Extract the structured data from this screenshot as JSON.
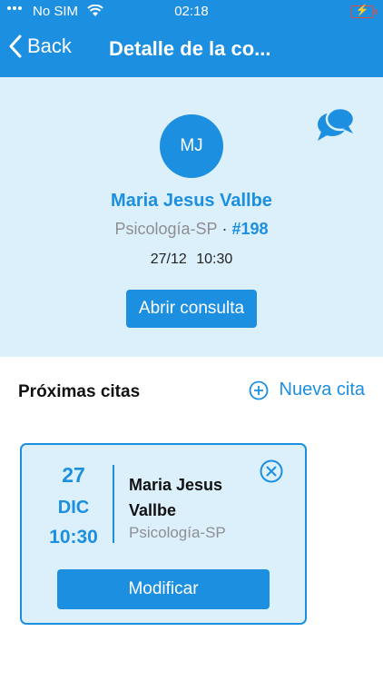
{
  "status_bar": {
    "carrier": "No SIM",
    "time": "02:18",
    "battery_icon": "battery-charging-icon"
  },
  "nav": {
    "back_label": "Back",
    "title": "Detalle de la co..."
  },
  "patient": {
    "initials": "MJ",
    "name": "Maria Jesus Vallbe",
    "specialty": "Psicología-SP",
    "separator": "·",
    "number": "#198",
    "date": "27/12",
    "time": "10:30",
    "open_button": "Abrir consulta"
  },
  "upcoming": {
    "title": "Próximas citas",
    "new_label": "Nueva cita",
    "appointments": [
      {
        "day": "27",
        "month": "DIC",
        "time": "10:30",
        "name": "Maria Jesus Vallbe",
        "specialty": "Psicología-SP",
        "modify_label": "Modificar"
      }
    ]
  },
  "colors": {
    "primary": "#1c8fe0",
    "light_bg": "#dcf0fb",
    "muted": "#8e8e93"
  }
}
